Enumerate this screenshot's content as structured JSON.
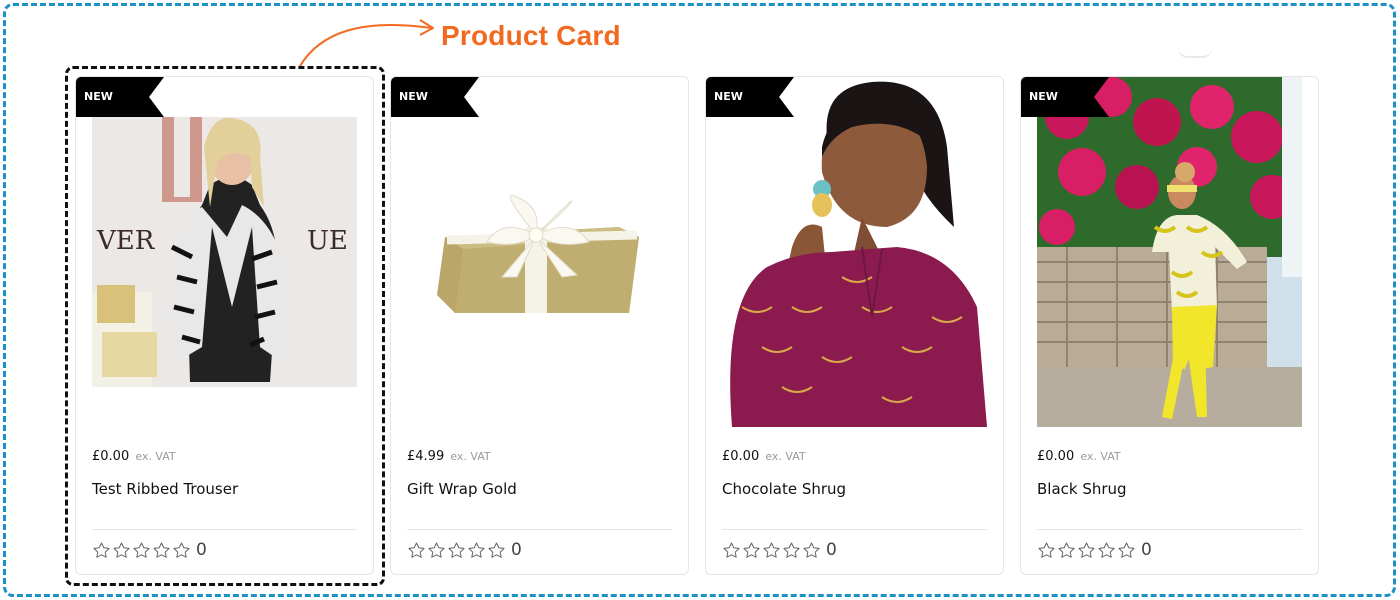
{
  "annotation": {
    "title": "Product Card",
    "accent_color": "#f26a21",
    "frame_color": "#1e90c8"
  },
  "products": [
    {
      "badge": "NEW",
      "price": "£0.00",
      "price_suffix": "ex. VAT",
      "name": "Test Ribbed Trouser",
      "rating": 0,
      "rating_count": "0",
      "image": "woman-in-zebra-jacket-photo"
    },
    {
      "badge": "NEW",
      "price": "£4.99",
      "price_suffix": "ex. VAT",
      "name": "Gift Wrap Gold",
      "rating": 0,
      "rating_count": "0",
      "image": "gold-gift-box-photo"
    },
    {
      "badge": "NEW",
      "price": "£0.00",
      "price_suffix": "ex. VAT",
      "name": "Chocolate Shrug",
      "rating": 0,
      "rating_count": "0",
      "image": "woman-in-magenta-top-photo"
    },
    {
      "badge": "NEW",
      "price": "£0.00",
      "price_suffix": "ex. VAT",
      "name": "Black Shrug",
      "rating": 0,
      "rating_count": "0",
      "image": "woman-in-yellow-trousers-photo"
    }
  ],
  "icons": {
    "rating_star": "star-outline-icon"
  }
}
